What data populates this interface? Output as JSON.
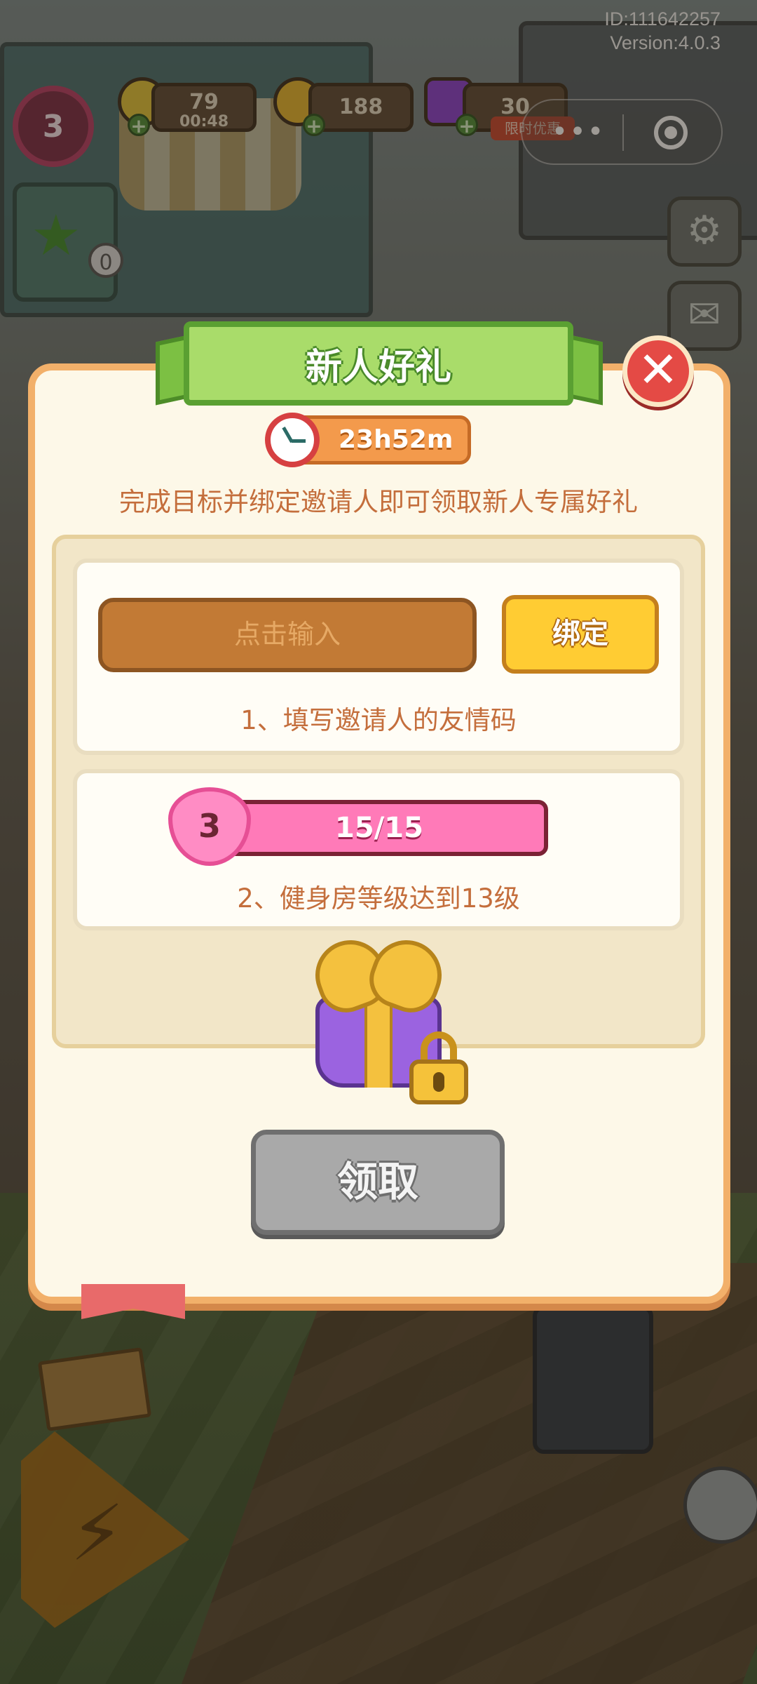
{
  "hud": {
    "id_text": "ID:111642257",
    "version_text": "Version:4.0.3",
    "level": "3",
    "energy": "79",
    "energy_timer": "00:48",
    "coins": "188",
    "gems": "30",
    "gem_tag": "限时优惠",
    "task_count": "0"
  },
  "dialog": {
    "title": "新人好礼",
    "timer": "23h52m",
    "subtitle": "完成目标并绑定邀请人即可领取新人专属好礼",
    "code_placeholder": "点击输入",
    "bind_label": "绑定",
    "task1_label": "1、填写邀请人的友情码",
    "task2_level": "3",
    "task2_progress": "15/15",
    "task2_progress_fraction": 1.0,
    "task2_label": "2、健身房等级达到13级",
    "claim_label": "领取"
  },
  "icons": {
    "close": "close-icon",
    "clock": "clock-icon",
    "gift": "gift-icon",
    "lock": "lock-icon",
    "heart": "heart-icon",
    "settings": "gear-icon",
    "mail": "mail-icon",
    "more": "more-icon",
    "target": "target-icon"
  },
  "colors": {
    "dialog_border": "#f2b06a",
    "ribbon": "#a9dc6a",
    "bind_button": "#ffcc33",
    "progress_fill": "#ff7ab8",
    "claim_disabled": "#a9a9a9",
    "close_button": "#e44a45"
  }
}
